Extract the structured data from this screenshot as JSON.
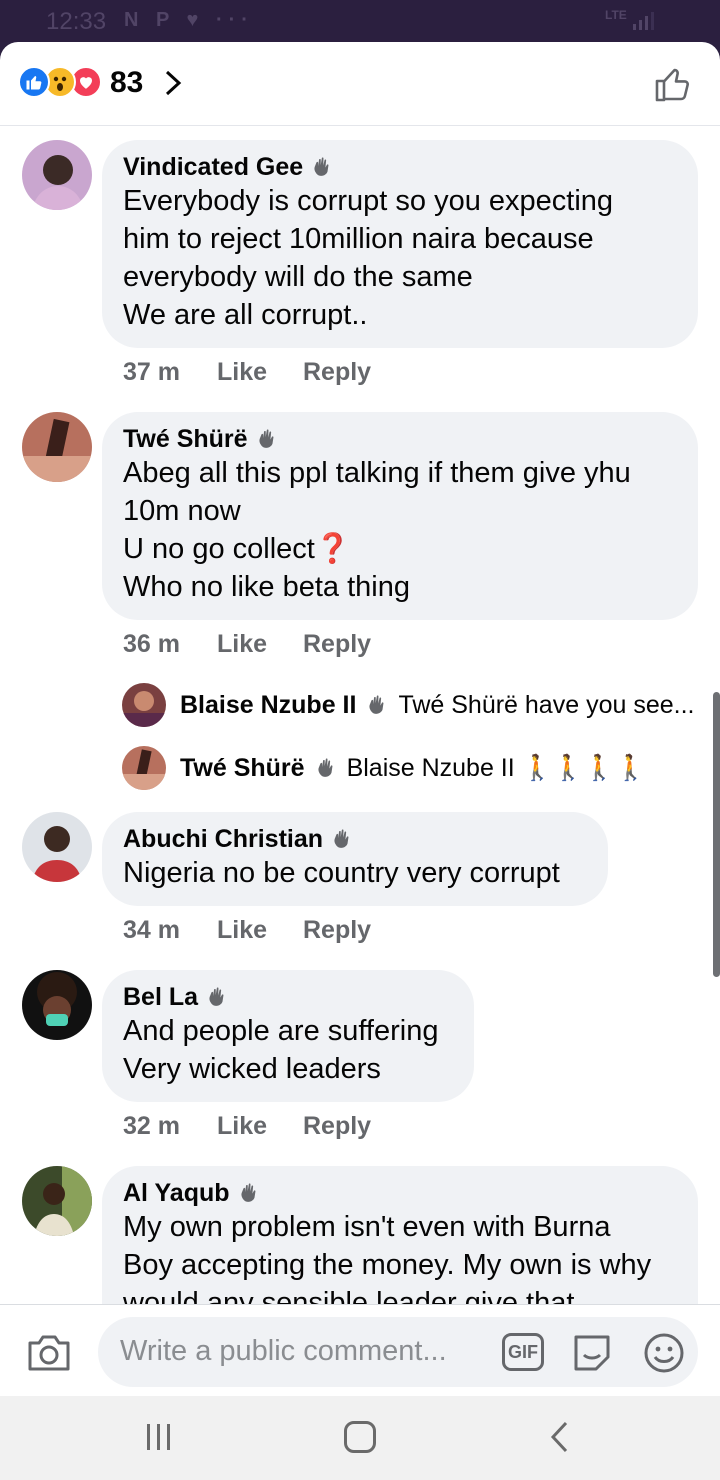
{
  "status_bar": {
    "time": "12:33",
    "icons": "N P ♥ ···",
    "network": "LTE"
  },
  "header": {
    "reaction_count": "83",
    "reaction_icons": [
      "like-icon",
      "wow-icon",
      "love-icon"
    ]
  },
  "comments": [
    {
      "name": "Vindicated Gee",
      "text": "Everybody is corrupt so you expecting\nhim to reject 10million naira   because\neverybody will do the same\nWe are all corrupt..",
      "time": "37 m"
    },
    {
      "name": "Twé Shürë",
      "text": "Abeg all this ppl talking if them give yhu\n10m now\nU no go collect❓\nWho no like beta thing",
      "time": "36 m"
    },
    {
      "name": "Abuchi Christian",
      "text": "Nigeria no be country very corrupt",
      "time": "34 m"
    },
    {
      "name": "Bel La",
      "text": "And people are suffering\nVery wicked leaders",
      "time": "32 m"
    },
    {
      "name": "Al Yaqub",
      "text": "My own problem isn't even with Burna\nBoy accepting the money. My own is why\nwould any sensible leader give that"
    }
  ],
  "replies": [
    {
      "name": "Blaise Nzube II",
      "text": "Twé Shürë have you see..."
    },
    {
      "name": "Twé Shürë",
      "text": "Blaise Nzube II 🚶🚶🚶🚶"
    }
  ],
  "actions": {
    "like": "Like",
    "reply": "Reply"
  },
  "composer": {
    "placeholder": "Write a public comment...",
    "gif": "GIF"
  },
  "colors": {
    "accent": "#1877f2",
    "bubble": "#f0f2f5",
    "meta": "#65676b"
  }
}
